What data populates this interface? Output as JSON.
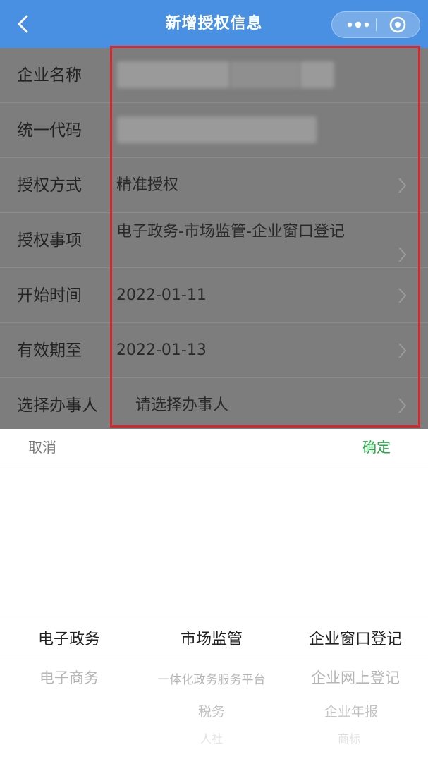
{
  "header": {
    "title": "新增授权信息",
    "back_icon": "chevron-left-icon",
    "more_icon": "more-dots-icon",
    "close_icon": "target-close-icon"
  },
  "form": {
    "rows": [
      {
        "label": "企业名称",
        "value": ""
      },
      {
        "label": "统一代码",
        "value": ""
      },
      {
        "label": "授权方式",
        "value": "精准授权"
      },
      {
        "label": "授权事项",
        "value": "电子政务-市场监管-企业窗口登记"
      },
      {
        "label": "开始时间",
        "value": "2022-01-11"
      },
      {
        "label": "有效期至",
        "value": "2022-01-13"
      },
      {
        "label": "选择办事人",
        "value": "请选择办事人"
      }
    ]
  },
  "picker": {
    "cancel_label": "取消",
    "confirm_label": "确定",
    "col1": {
      "selected": "电子政务",
      "options": [
        "电子商务"
      ]
    },
    "col2": {
      "selected": "市场监管",
      "options": [
        "一体化政务服务平台",
        "税务",
        "人社"
      ]
    },
    "col3": {
      "selected": "企业窗口登记",
      "options": [
        "企业网上登记",
        "企业年报",
        "商标"
      ]
    }
  },
  "colors": {
    "navbar": "#4a90e2",
    "overlay": "#7d7d7d",
    "highlight": "#d8262a",
    "confirm": "#27a845"
  }
}
